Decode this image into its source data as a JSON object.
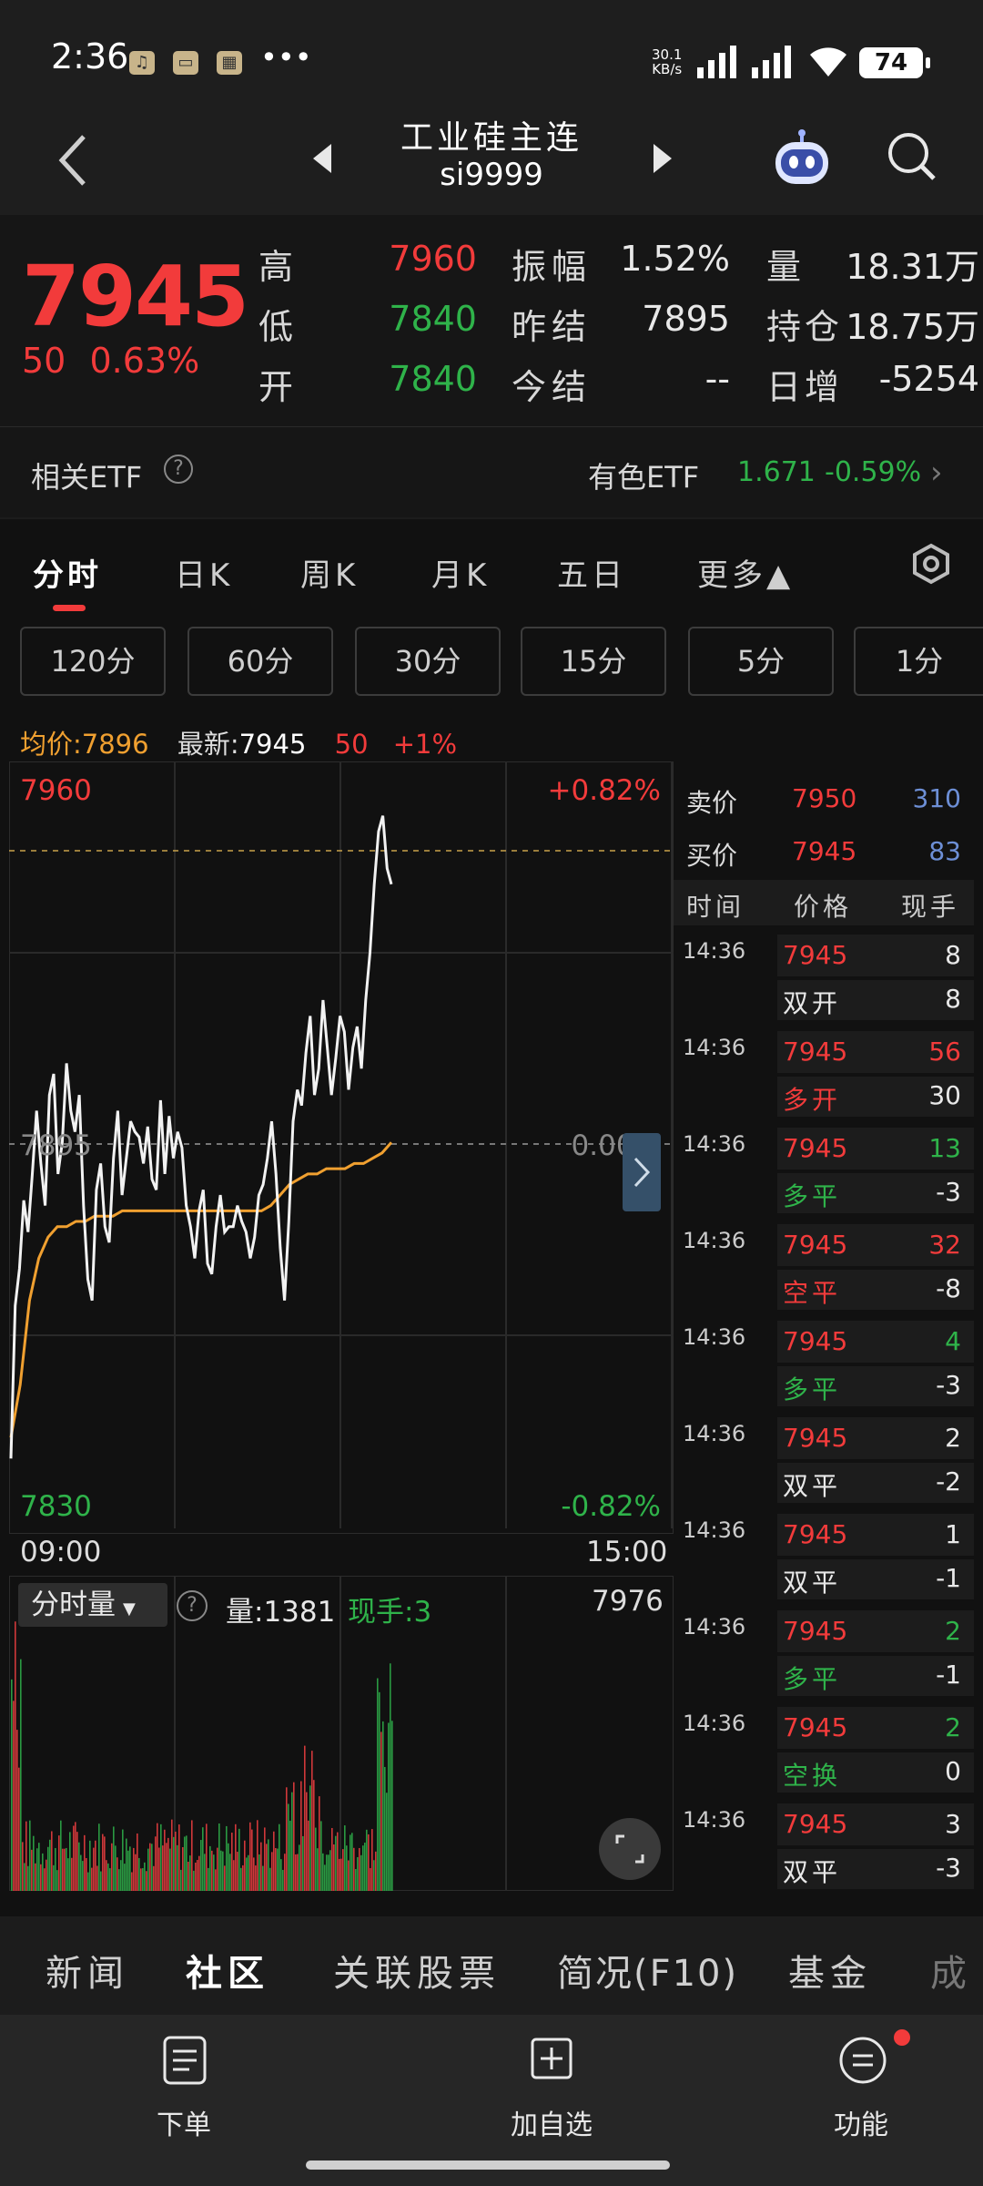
{
  "status_bar": {
    "time": "2:36",
    "more": "•••",
    "net_speed_value": "30.1",
    "net_speed_unit": "KB/s",
    "battery": "74"
  },
  "header": {
    "title": "工业硅主连",
    "symbol": "si9999"
  },
  "quote": {
    "price": "7945",
    "change": "50",
    "change_pct": "0.63%",
    "fields": [
      {
        "label": "高",
        "value": "7960",
        "color": "#f23b3b"
      },
      {
        "label": "低",
        "value": "7840",
        "color": "#2fb34a"
      },
      {
        "label": "开",
        "value": "7840",
        "color": "#2fb34a"
      },
      {
        "label": "振幅",
        "value": "1.52%",
        "color": "#e8e8e8"
      },
      {
        "label": "昨结",
        "value": "7895",
        "color": "#e8e8e8"
      },
      {
        "label": "今结",
        "value": "--",
        "color": "#e8e8e8"
      },
      {
        "label": "量",
        "value": "18.31万",
        "color": "#e8e8e8"
      },
      {
        "label": "持仓",
        "value": "18.75万",
        "color": "#e8e8e8"
      },
      {
        "label": "日增",
        "value": "-5254",
        "color": "#e8e8e8"
      }
    ]
  },
  "etf": {
    "label": "相关ETF",
    "help": "?",
    "name": "有色ETF",
    "price": "1.671",
    "pct": "-0.59%"
  },
  "tabs": [
    "分时",
    "日K",
    "周K",
    "月K",
    "五日",
    "更多▲"
  ],
  "periods": [
    "120分",
    "60分",
    "30分",
    "15分",
    "5分",
    "1分"
  ],
  "summary": {
    "avg_label": "均价:",
    "avg_value": "7896",
    "latest_label": "最新:",
    "latest_value": "7945",
    "change": "50",
    "pct": "+1%"
  },
  "chart_labels": {
    "top_price": "7960",
    "top_pct": "+0.82%",
    "mid_price": "7895",
    "mid_pct": "0.00%",
    "bottom_price": "7830",
    "bottom_pct": "-0.82%",
    "time_start": "09:00",
    "time_end": "15:00"
  },
  "chart_data": {
    "type": "line",
    "ylim": [
      7830,
      7960
    ],
    "reference": 7895,
    "series": [
      {
        "values": [
          7836,
          7865,
          7872,
          7885,
          7879,
          7890,
          7902,
          7892,
          7884,
          7905,
          7909,
          7890,
          7896,
          7911,
          7902,
          7898,
          7905,
          7884,
          7870,
          7866,
          7887,
          7892,
          7880,
          7877,
          7893,
          7902,
          7886,
          7893,
          7900,
          7898,
          7897,
          7892,
          7899,
          7889,
          7887,
          7904,
          7890,
          7901,
          7893,
          7898,
          7895,
          7884,
          7880,
          7874,
          7883,
          7887,
          7873,
          7871,
          7880,
          7886,
          7879,
          7880,
          7880,
          7884,
          7881,
          7879,
          7874,
          7878,
          7886,
          7888,
          7893,
          7900,
          7890,
          7876,
          7866,
          7881,
          7900,
          7906,
          7903,
          7913,
          7920,
          7905,
          7910,
          7923,
          7914,
          7905,
          7912,
          7920,
          7917,
          7906,
          7914,
          7918,
          7910,
          7923,
          7932,
          7945,
          7955,
          7958,
          7948,
          7945
        ]
      },
      {
        "values": [
          7840,
          7850,
          7866,
          7874,
          7878,
          7880,
          7880,
          7881,
          7881,
          7882,
          7882,
          7882,
          7883,
          7883,
          7883,
          7883,
          7883,
          7883,
          7883,
          7883,
          7883,
          7883,
          7883,
          7883,
          7883,
          7883,
          7883,
          7883,
          7884,
          7886,
          7888,
          7889,
          7890,
          7890,
          7891,
          7891,
          7891,
          7892,
          7892,
          7893,
          7894,
          7896
        ]
      }
    ]
  },
  "volume": {
    "label": "分时量",
    "help": "?",
    "qty_label": "量:",
    "qty_value": "1381",
    "hand_label": "现手:",
    "hand_value": "3",
    "max": "7976"
  },
  "orderbook": {
    "sell_label": "卖价",
    "sell_price": "7950",
    "sell_qty": "310",
    "buy_label": "买价",
    "buy_price": "7945",
    "buy_qty": "83",
    "headers": [
      "时间",
      "价格",
      "现手"
    ]
  },
  "trades": [
    {
      "time": "14:36",
      "price": "7945",
      "qty": "8",
      "qty_color": "#e8e8e8",
      "type": "双开",
      "type_color": "#e8e8e8",
      "oi": "8"
    },
    {
      "time": "14:36",
      "price": "7945",
      "qty": "56",
      "qty_color": "#f23b3b",
      "type": "多开",
      "type_color": "#f23b3b",
      "oi": "30"
    },
    {
      "time": "14:36",
      "price": "7945",
      "qty": "13",
      "qty_color": "#2fb34a",
      "type": "多平",
      "type_color": "#2fb34a",
      "oi": "-3"
    },
    {
      "time": "14:36",
      "price": "7945",
      "qty": "32",
      "qty_color": "#f23b3b",
      "type": "空平",
      "type_color": "#f23b3b",
      "oi": "-8"
    },
    {
      "time": "14:36",
      "price": "7945",
      "qty": "4",
      "qty_color": "#2fb34a",
      "type": "多平",
      "type_color": "#2fb34a",
      "oi": "-3"
    },
    {
      "time": "14:36",
      "price": "7945",
      "qty": "2",
      "qty_color": "#e8e8e8",
      "type": "双平",
      "type_color": "#e8e8e8",
      "oi": "-2"
    },
    {
      "time": "14:36",
      "price": "7945",
      "qty": "1",
      "qty_color": "#e8e8e8",
      "type": "双平",
      "type_color": "#e8e8e8",
      "oi": "-1"
    },
    {
      "time": "14:36",
      "price": "7945",
      "qty": "2",
      "qty_color": "#2fb34a",
      "type": "多平",
      "type_color": "#2fb34a",
      "oi": "-1"
    },
    {
      "time": "14:36",
      "price": "7945",
      "qty": "2",
      "qty_color": "#2fb34a",
      "type": "空换",
      "type_color": "#2fb34a",
      "oi": "0"
    },
    {
      "time": "14:36",
      "price": "7945",
      "qty": "3",
      "qty_color": "#e8e8e8",
      "type": "双平",
      "type_color": "#e8e8e8",
      "oi": "-3"
    }
  ],
  "bottom_tabs": [
    "新闻",
    "社区",
    "关联股票",
    "简况(F10)",
    "基金",
    "成"
  ],
  "toolbar": [
    "下单",
    "加自选",
    "功能"
  ],
  "colors": {
    "up": "#f23b3b",
    "down": "#2fb34a",
    "avg": "#f0a030",
    "bg": "#111111"
  }
}
